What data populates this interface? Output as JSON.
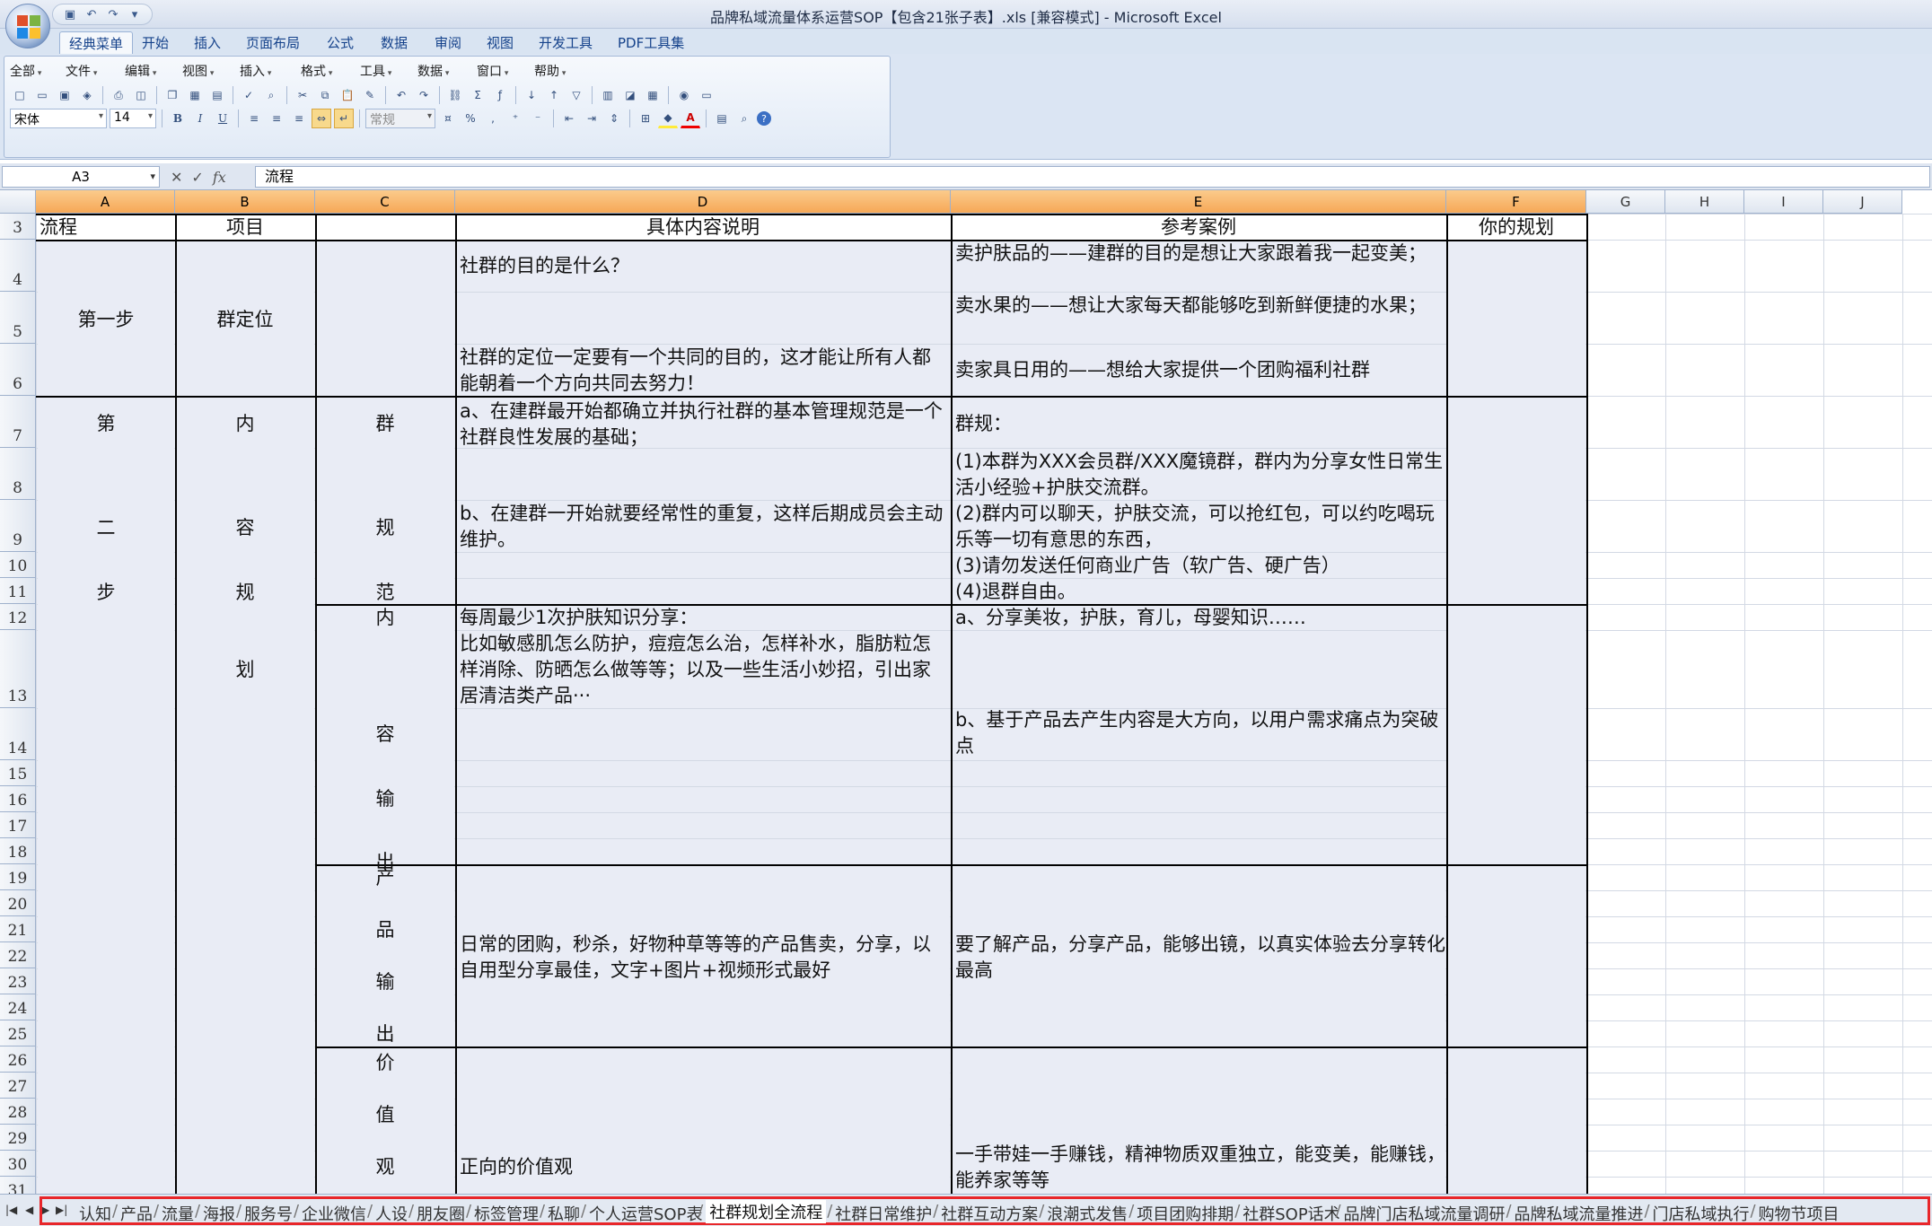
{
  "window": {
    "title": "品牌私域流量体系运营SOP【包含21张子表】.xls  [兼容模式] - Microsoft Excel"
  },
  "ribbon": {
    "tabs": [
      {
        "label": "经典菜单",
        "active": true
      },
      {
        "label": "开始"
      },
      {
        "label": "插入"
      },
      {
        "label": "页面布局"
      },
      {
        "label": "公式"
      },
      {
        "label": "数据"
      },
      {
        "label": "审阅"
      },
      {
        "label": "视图"
      },
      {
        "label": "开发工具"
      },
      {
        "label": "PDF工具集"
      }
    ],
    "menus": [
      "全部",
      "文件",
      "编辑",
      "视图",
      "插入",
      "格式",
      "工具",
      "数据",
      "窗口",
      "帮助"
    ],
    "font_name": "宋体",
    "font_size": "14",
    "number_format": "常规",
    "bold_label": "B",
    "italic_label": "I",
    "underline_label": "U",
    "font_color_label": "A"
  },
  "formula_bar": {
    "name_box": "A3",
    "formula": "流程"
  },
  "columns": [
    "A",
    "B",
    "C",
    "D",
    "E",
    "F",
    "G",
    "H",
    "I",
    "J"
  ],
  "rows": [
    "3",
    "4",
    "5",
    "6",
    "7",
    "8",
    "9",
    "10",
    "11",
    "12",
    "13",
    "14",
    "15",
    "16",
    "17",
    "18",
    "19",
    "20",
    "21",
    "22",
    "23",
    "24",
    "25",
    "26",
    "27",
    "28",
    "29",
    "30",
    "31"
  ],
  "grid": {
    "header": {
      "a": "流程",
      "b": "项目",
      "d": "具体内容说明",
      "e": "参考案例",
      "f": "你的规划"
    },
    "step1": {
      "a": "第一步",
      "b": "群定位",
      "d1": "社群的目的是什么？",
      "d2": "社群的定位一定要有一个共同的目的，这才能让所有人都能朝着一个方向共同去努力！",
      "e1": "卖护肤品的——建群的目的是想让大家跟着我一起变美；",
      "e2": "卖水果的——想让大家每天都能够吃到新鲜便捷的水果；",
      "e3": "卖家具日用的——想给大家提供一个团购福利社群"
    },
    "step2": {
      "a_chars": [
        "第",
        "二",
        "步"
      ],
      "b_chars": [
        "内",
        "容",
        "规",
        "划"
      ],
      "c_rules_chars": [
        "群",
        "规",
        "范"
      ],
      "d_rules_1": "a、在建群最开始都确立并执行社群的基本管理规范是一个社群良性发展的基础；",
      "d_rules_2": "b、在建群一开始就要经常性的重复，这样后期成员会主动维护。",
      "e_rules_0": "群规：",
      "e_rules_1": "(1)本群为XXX会员群/XXX魔镜群，群内为分享女性日常生活小经验+护肤交流群。",
      "e_rules_2": "(2)群内可以聊天，护肤交流，可以抢红包，可以约吃喝玩乐等一切有意思的东西，",
      "e_rules_3": "(3)请勿发送任何商业广告（软广告、硬广告）",
      "e_rules_4": "(4)退群自由。",
      "c_content_chars": [
        "内",
        "容",
        "输",
        "出"
      ],
      "d_content": "每周最少1次护肤知识分享：\n比如敏感肌怎么防护，痘痘怎么治，怎样补水，脂肪粒怎样消除、防晒怎么做等等；以及一些生活小妙招，引出家居清洁类产品···",
      "e_content_1": "a、分享美妆，护肤，育儿，母婴知识……",
      "e_content_2": "b、基于产品去产生内容是大方向，以用户需求痛点为突破点",
      "c_product_chars": [
        "产",
        "品",
        "输",
        "出"
      ],
      "d_product": "日常的团购，秒杀，好物种草等等的产品售卖，分享，以自用型分享最佳，文字+图片+视频形式最好",
      "e_product": "要了解产品，分享产品，能够出镜，以真实体验去分享转化最高",
      "c_values_chars": [
        "价",
        "值",
        "观"
      ],
      "d_values": "正向的价值观",
      "e_values": "一手带娃一手赚钱，精神物质双重独立，能变美，能赚钱，能养家等等"
    }
  },
  "sheet_tabs": [
    {
      "label": "认知"
    },
    {
      "label": "产品"
    },
    {
      "label": "流量"
    },
    {
      "label": "海报"
    },
    {
      "label": "服务号"
    },
    {
      "label": "企业微信"
    },
    {
      "label": "人设"
    },
    {
      "label": "朋友圈"
    },
    {
      "label": "标签管理"
    },
    {
      "label": "私聊"
    },
    {
      "label": "个人运营SOP表"
    },
    {
      "label": "社群规划全流程",
      "active": true
    },
    {
      "label": "社群日常维护"
    },
    {
      "label": "社群互动方案"
    },
    {
      "label": "浪潮式发售"
    },
    {
      "label": "项目团购排期"
    },
    {
      "label": "社群SOP话术"
    },
    {
      "label": "品牌门店私域流量调研"
    },
    {
      "label": "品牌私域流量推进"
    },
    {
      "label": "门店私域执行"
    },
    {
      "label": "购物节项目"
    }
  ],
  "colors": {
    "selected_header": "#f6a857",
    "cell_fill": "#e9ecf5",
    "tab_highlight": "#e8262a",
    "ribbon_text": "#15428b"
  }
}
